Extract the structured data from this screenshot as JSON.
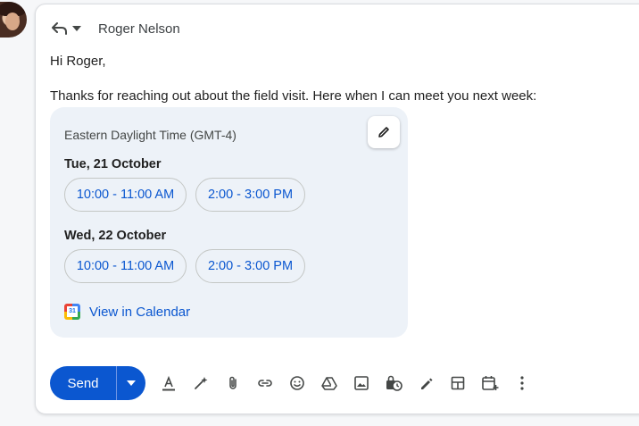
{
  "header": {
    "recipient": "Roger Nelson",
    "reply_icon": "reply-icon",
    "reply_options_icon": "caret-down-icon"
  },
  "message": {
    "greeting": "Hi Roger,",
    "body": "Thanks for reaching out about the field visit. Here when I can meet you next week:"
  },
  "schedule": {
    "timezone": "Eastern Daylight Time (GMT-4)",
    "days": [
      {
        "label": "Tue, 21 October",
        "slots": [
          "10:00 - 11:00 AM",
          "2:00 - 3:00 PM"
        ]
      },
      {
        "label": "Wed, 22 October",
        "slots": [
          "10:00 - 11:00 AM",
          "2:00 - 3:00 PM"
        ]
      }
    ],
    "calendar_icon_day": "31",
    "view_calendar_label": "View in Calendar"
  },
  "toolbar": {
    "send_label": "Send",
    "icons": [
      "formatting-icon",
      "ai-write-icon",
      "attach-icon",
      "link-icon",
      "emoji-icon",
      "drive-icon",
      "photo-icon",
      "confidential-icon",
      "signature-icon",
      "template-icon",
      "schedule-event-icon",
      "more-options-icon"
    ]
  },
  "colors": {
    "accent": "#0b57d0",
    "card_bg": "#edf2f8"
  }
}
